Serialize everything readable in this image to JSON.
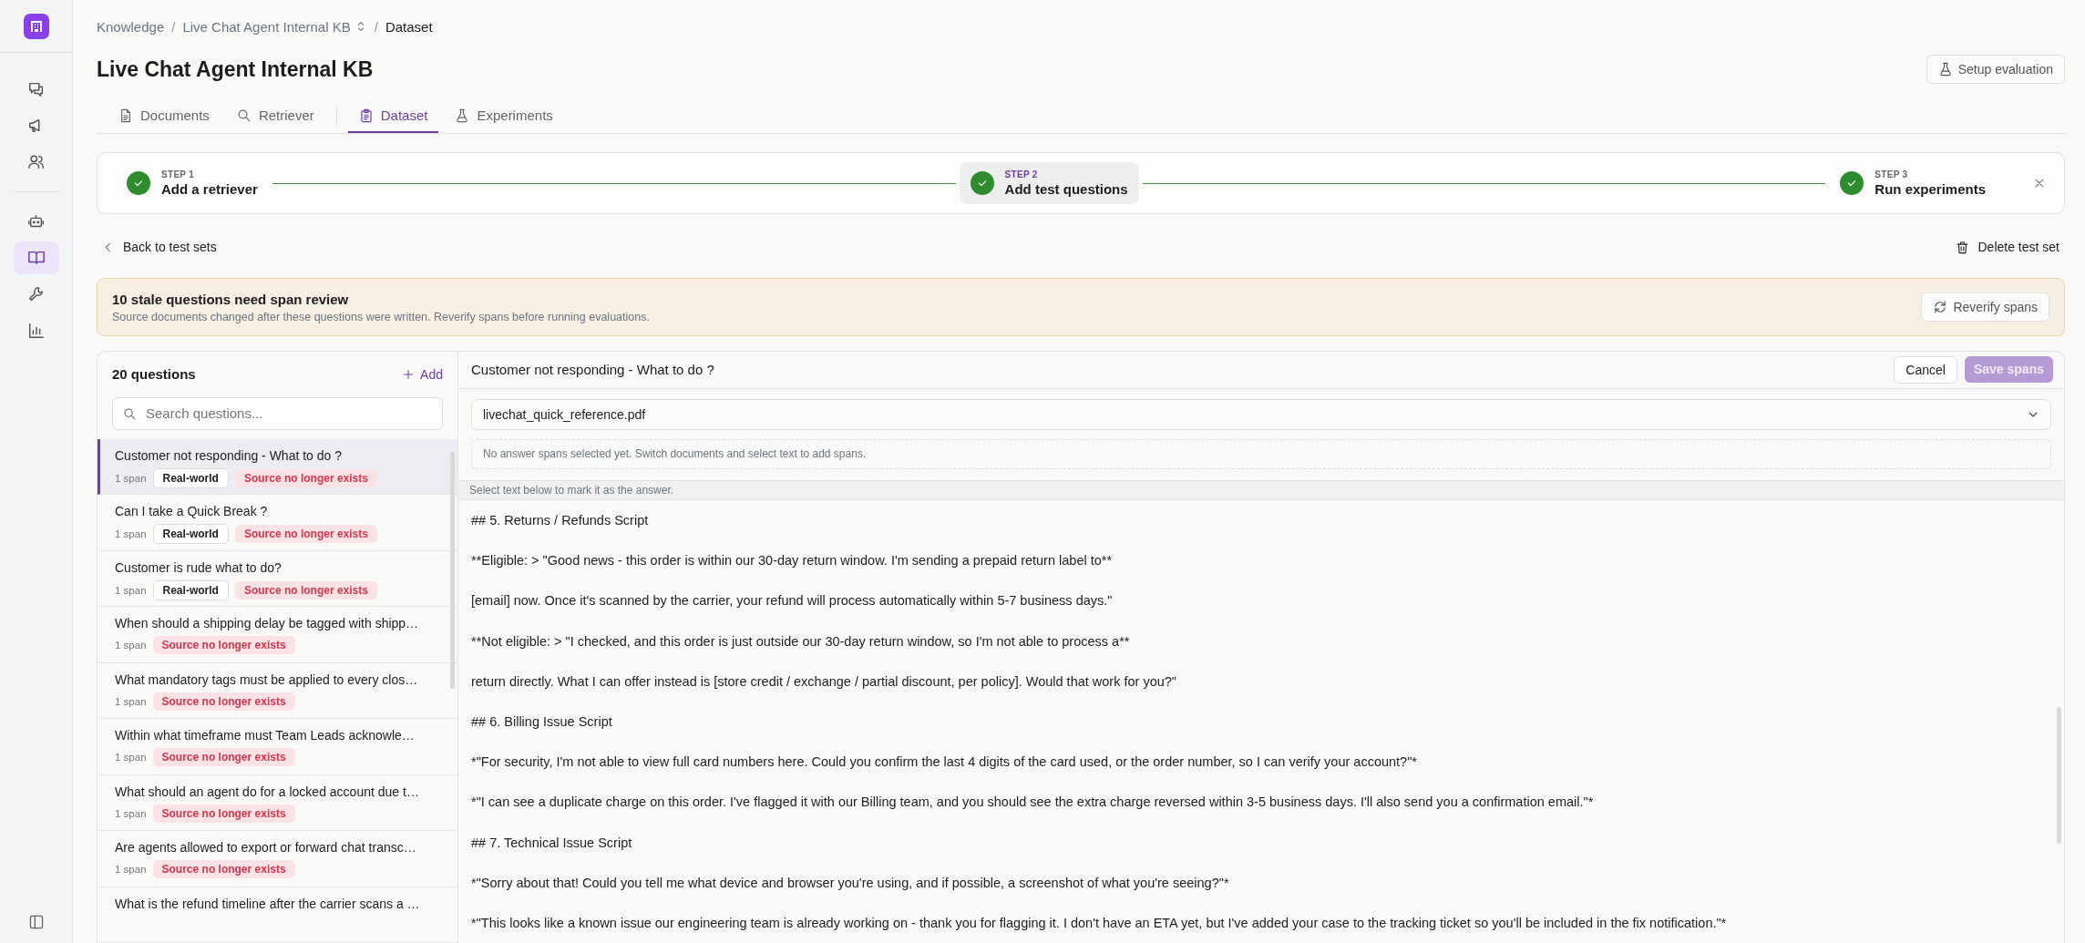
{
  "sidebar": {
    "items": [
      {
        "kind": "chat",
        "selected": false
      },
      {
        "kind": "megaphone",
        "selected": false
      },
      {
        "kind": "users",
        "selected": false
      },
      {
        "kind": "bot",
        "selected": false
      },
      {
        "kind": "book",
        "selected": true
      },
      {
        "kind": "wrench",
        "selected": false
      },
      {
        "kind": "chart",
        "selected": false
      }
    ]
  },
  "breadcrumb": [
    {
      "label": "Knowledge",
      "switcher": false,
      "current": false
    },
    {
      "separator": "/",
      "label": "Live Chat Agent Internal KB",
      "switcher": true,
      "current": false
    },
    {
      "separator": "/",
      "label": "Dataset",
      "switcher": false,
      "current": true
    }
  ],
  "title": "Live Chat Agent Internal KB",
  "setup_button": "Setup evaluation",
  "tabs": [
    {
      "label": "Documents",
      "kind": "document",
      "selected": false
    },
    {
      "label": "Retriever",
      "kind": "search",
      "selected": false
    },
    {
      "label": "Dataset",
      "kind": "clipboard",
      "selected": true
    },
    {
      "label": "Experiments",
      "kind": "flask",
      "selected": false
    }
  ],
  "stepper": {
    "steps": [
      {
        "step": "STEP 1",
        "label": "Add a retriever",
        "done": true,
        "selected": false
      },
      {
        "step": "STEP 2",
        "label": "Add test questions",
        "done": true,
        "selected": true
      },
      {
        "step": "STEP 3",
        "label": "Run experiments",
        "done": true,
        "selected": false
      }
    ]
  },
  "back_link": "Back to test sets",
  "delete_button": "Delete test set",
  "banner": {
    "title": "10 stale questions need span review",
    "text": "Source documents changed after these questions were written. Reverify spans before running evaluations.",
    "button": "Reverify spans"
  },
  "questions": {
    "title": "20 questions",
    "add_button": "Add",
    "search_placeholder": "Search questions...",
    "items": [
      {
        "title": "Customer not responding - What to do ?",
        "spans": "1 span",
        "selected": true,
        "tags": [
          {
            "label": "Real-world",
            "kind": "category"
          },
          {
            "label": "Source no longer exists",
            "kind": "warning"
          }
        ]
      },
      {
        "title": "Can I take a Quick Break ?",
        "spans": "1 span",
        "selected": false,
        "tags": [
          {
            "label": "Real-world",
            "kind": "category"
          },
          {
            "label": "Source no longer exists",
            "kind": "warning"
          }
        ]
      },
      {
        "title": "Customer is rude what to do?",
        "spans": "1 span",
        "selected": false,
        "tags": [
          {
            "label": "Real-world",
            "kind": "category"
          },
          {
            "label": "Source no longer exists",
            "kind": "warning"
          }
        ]
      },
      {
        "title": "When should a shipping delay be tagged with shipp…",
        "spans": "1 span",
        "selected": false,
        "tags": [
          {
            "label": "Source no longer exists",
            "kind": "warning"
          }
        ]
      },
      {
        "title": "What mandatory tags must be applied to every clos…",
        "spans": "1 span",
        "selected": false,
        "tags": [
          {
            "label": "Source no longer exists",
            "kind": "warning"
          }
        ]
      },
      {
        "title": "Within what timeframe must Team Leads acknowle…",
        "spans": "1 span",
        "selected": false,
        "tags": [
          {
            "label": "Source no longer exists",
            "kind": "warning"
          }
        ]
      },
      {
        "title": "What should an agent do for a locked account due t…",
        "spans": "1 span",
        "selected": false,
        "tags": [
          {
            "label": "Source no longer exists",
            "kind": "warning"
          }
        ]
      },
      {
        "title": "Are agents allowed to export or forward chat transc…",
        "spans": "1 span",
        "selected": false,
        "tags": [
          {
            "label": "Source no longer exists",
            "kind": "warning"
          }
        ]
      },
      {
        "title": "What is the refund timeline after the carrier scans a …",
        "selected": false
      }
    ]
  },
  "editor": {
    "question": "Customer not responding - What to do ?",
    "cancel_button": "Cancel",
    "save_button": {
      "label": "Save spans",
      "disabled": true
    },
    "document": "livechat_quick_reference.pdf",
    "empty_hint": "No answer spans selected yet. Switch documents and select text to add spans.",
    "instruction": "Select text below to mark it as the answer.",
    "lines": [
      "## 5. Returns / Refunds Script",
      "**Eligible: > \"Good news - this order is within our 30-day return window. I'm sending a prepaid return label to**",
      "[email] now. Once it's scanned by the carrier, your refund will process automatically within 5-7 business days.\"",
      "**Not eligible: > \"I checked, and this order is just outside our 30-day return window, so I'm not able to process a**",
      "return directly. What I can offer instead is [store credit / exchange / partial discount, per policy]. Would that work for you?\"",
      "## 6. Billing Issue Script",
      "*\"For security, I'm not able to view full card numbers here. Could you confirm the last 4 digits of the card used, or the order number, so I can verify your account?\"*",
      "*\"I can see a duplicate charge on this order. I've flagged it with our Billing team, and you should see the extra charge reversed within 3-5 business days. I'll also send you a confirmation email.\"*",
      "## 7. Technical Issue Script",
      "*\"Sorry about that! Could you tell me what device and browser you're using, and if possible, a screenshot of what you're seeing?\"*",
      "*\"This looks like a known issue our engineering team is already working on - thank you for flagging it. I don't have an ETA yet, but I've added your case to the tracking ticket so you'll be included in the fix notification.\"*"
    ]
  }
}
